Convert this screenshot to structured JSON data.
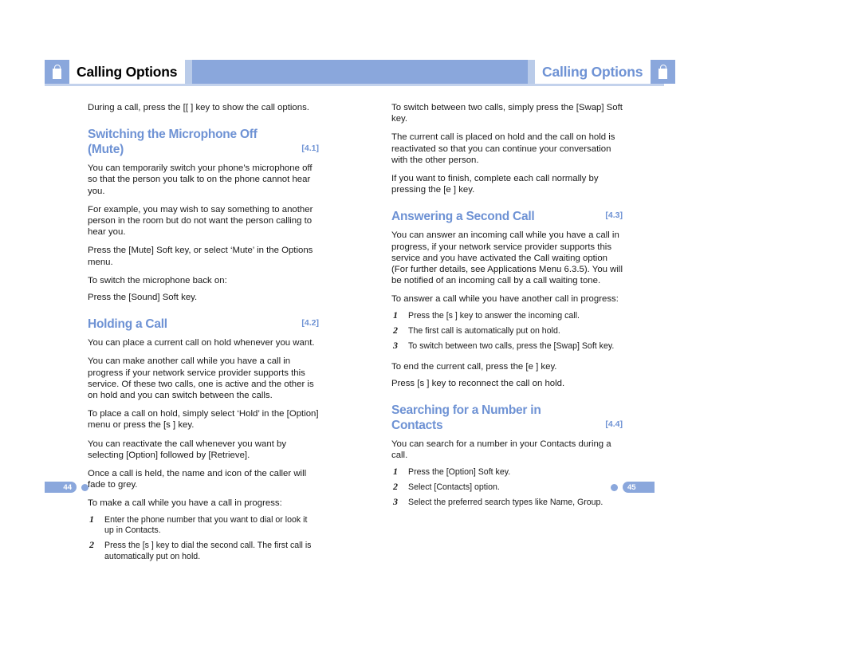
{
  "document": {
    "chapter_title_left": "Calling Options",
    "chapter_title_right": "Calling Options",
    "icon": "phone-handset-icon"
  },
  "colors": {
    "accent": "#8aa7dc",
    "heading": "#6e92d4",
    "rule": "#c3d2ec",
    "body_text": "#1a1a1a"
  },
  "left_page": {
    "page_number": "44",
    "intro": "During a call, press the [[   ] key to show the call options.",
    "sections": [
      {
        "heading": "Switching the Microphone Off (Mute)",
        "number": "[4.1]",
        "paragraphs": [
          "You can temporarily switch your phone’s microphone off so that the person you talk to on the phone cannot hear you.",
          "For example, you may wish to say something to another person in the room but do not want the person calling to hear you.",
          "Press the [Mute] Soft key, or select ‘Mute’ in the Options menu.",
          "To switch the microphone back on:",
          "Press the [Sound] Soft key."
        ]
      },
      {
        "heading": "Holding a Call",
        "number": "[4.2]",
        "paragraphs": [
          "You can place a current call on hold whenever you want.",
          "You can make another call while you have a call in progress if your network service provider supports this service. Of these two calls, one is active and the other is on hold and you can switch between the calls.",
          "To place a call on hold, simply select ‘Hold’ in the [Option] menu or press the [s   ] key.",
          "You can reactivate the call whenever you want by selecting [Option] followed by [Retrieve].",
          "Once a call is held, the name and icon of the caller will fade to grey.",
          "To make a call while you have a call in progress:"
        ],
        "steps": [
          {
            "num": "1",
            "text": "Enter the phone number that you want to dial or look it up in Contacts."
          },
          {
            "num": "2",
            "text": "Press the [s   ] key to dial the second call. The first call is automatically put on hold."
          }
        ]
      }
    ]
  },
  "right_page": {
    "page_number": "45",
    "lead_paragraphs": [
      "To switch between two calls, simply press the [Swap] Soft key.",
      "The current call is placed on hold and the call on hold is reactivated so that you can continue your conversation with the other person.",
      "If you want to finish, complete each call normally by pressing the [e   ] key."
    ],
    "sections": [
      {
        "heading": "Answering a Second Call",
        "number": "[4.3]",
        "paragraphs": [
          "You can answer an incoming call while you have a call in progress, if your network service provider supports this service and you have activated the Call waiting option (For further details, see Applications Menu 6.3.5). You will be notified of an incoming call by a call waiting tone.",
          "To answer a call while you have another call in progress:"
        ],
        "steps": [
          {
            "num": "1",
            "text": "Press the [s   ] key to answer the incoming call."
          },
          {
            "num": "2",
            "text": "The first call is automatically put on hold."
          },
          {
            "num": "3",
            "text": "To switch between two calls, press the [Swap] Soft key."
          }
        ],
        "after_paragraphs": [
          "To end the current call, press the [e   ] key.",
          "Press [s   ] key to reconnect the call on hold."
        ]
      },
      {
        "heading": "Searching for a Number in Contacts",
        "number": "[4.4]",
        "paragraphs": [
          "You can search for a number in your Contacts during a call."
        ],
        "steps": [
          {
            "num": "1",
            "text": "Press the [Option] Soft key."
          },
          {
            "num": "2",
            "text": "Select [Contacts] option."
          },
          {
            "num": "3",
            "text": "Select the preferred search types like Name, Group."
          }
        ]
      }
    ]
  }
}
